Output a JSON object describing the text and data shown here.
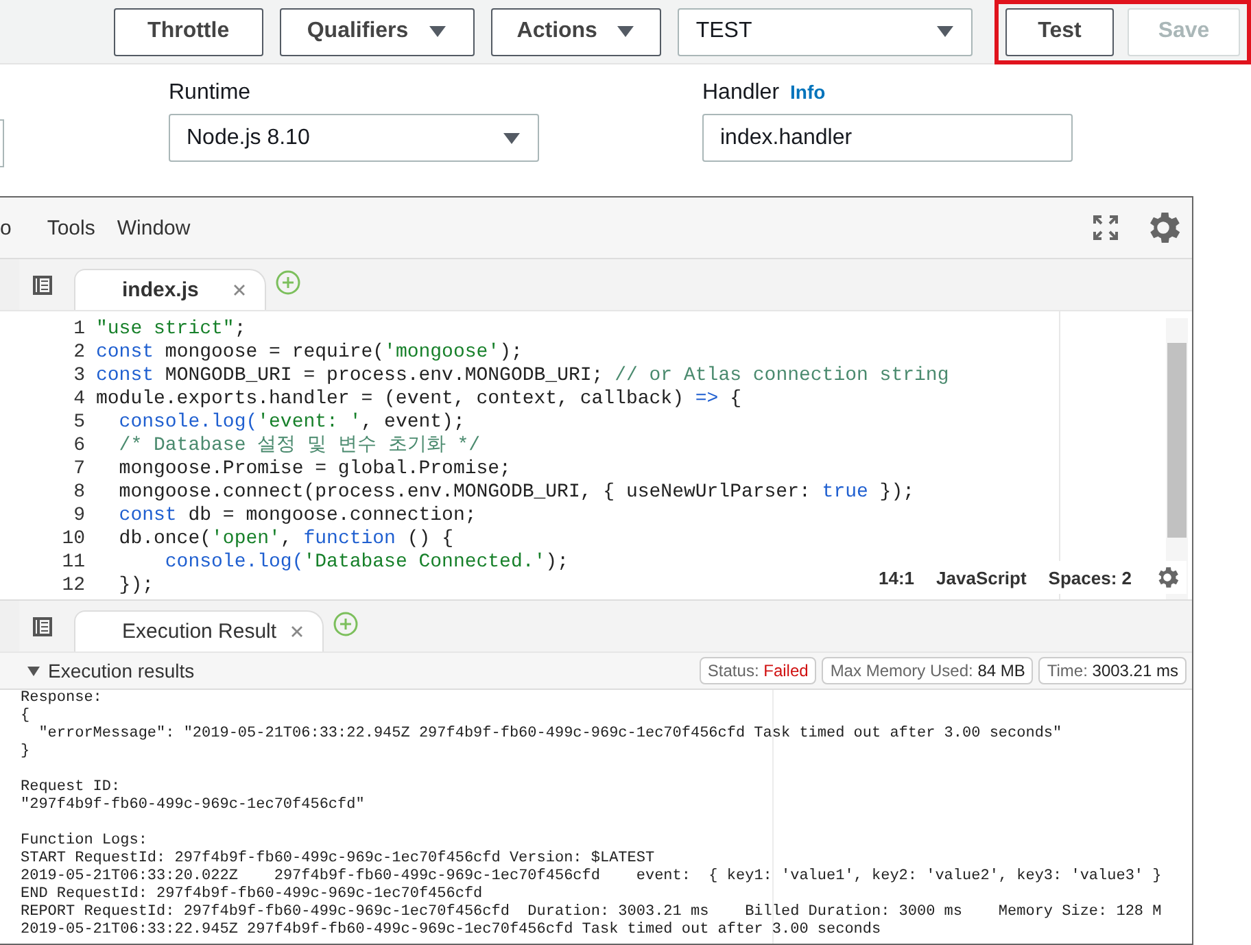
{
  "toolbar": {
    "buttons": [
      {
        "label": "Throttle",
        "kind": "button"
      },
      {
        "label": "Qualifiers",
        "kind": "dropdown"
      },
      {
        "label": "Actions",
        "kind": "dropdown"
      }
    ],
    "test_event": {
      "value": "TEST"
    },
    "actions": [
      {
        "label": "Test",
        "disabled": false
      },
      {
        "label": "Save",
        "disabled": true
      }
    ]
  },
  "settings": {
    "runtime": {
      "label": "Runtime",
      "value": "Node.js 8.10"
    },
    "handler": {
      "label": "Handler",
      "link": "Info",
      "value": "index.handler"
    }
  },
  "editor": {
    "menu": [
      "o",
      "Tools",
      "Window"
    ],
    "tabs": [
      {
        "label": "index.js",
        "selected": true
      }
    ],
    "lines": [
      {
        "number": "1",
        "tokens": [
          {
            "kind": "string",
            "text": "\"use strict\""
          },
          {
            "kind": "plain",
            "text": ";"
          }
        ]
      },
      {
        "number": "2",
        "tokens": [
          {
            "kind": "keyword",
            "text": "const"
          },
          {
            "kind": "plain",
            "text": " mongoose = require("
          },
          {
            "kind": "string",
            "text": "'mongoose'"
          },
          {
            "kind": "plain",
            "text": ");"
          }
        ]
      },
      {
        "number": "3",
        "tokens": [
          {
            "kind": "keyword",
            "text": "const"
          },
          {
            "kind": "plain",
            "text": " MONGODB_URI = process.env.MONGODB_URI; "
          },
          {
            "kind": "comment",
            "text": "// or Atlas connection string"
          }
        ]
      },
      {
        "number": "4",
        "tokens": [
          {
            "kind": "plain",
            "text": "module.exports.handler = (event, context, callback) "
          },
          {
            "kind": "keyword",
            "text": "=>"
          },
          {
            "kind": "plain",
            "text": " {"
          }
        ]
      },
      {
        "number": "5",
        "tokens": [
          {
            "kind": "keyword",
            "text": "  console.log("
          },
          {
            "kind": "string",
            "text": "'event: '"
          },
          {
            "kind": "plain",
            "text": ", event);"
          }
        ]
      },
      {
        "number": "6",
        "tokens": [
          {
            "kind": "comment",
            "text": "  /* Database 설정 및 변수 초기화 */"
          }
        ]
      },
      {
        "number": "7",
        "tokens": [
          {
            "kind": "plain",
            "text": "  mongoose.Promise = global.Promise;"
          }
        ]
      },
      {
        "number": "8",
        "tokens": [
          {
            "kind": "plain",
            "text": "  mongoose.connect(process.env.MONGODB_URI, { useNewUrlParser: "
          },
          {
            "kind": "keyword",
            "text": "true"
          },
          {
            "kind": "plain",
            "text": " });"
          }
        ]
      },
      {
        "number": "9",
        "tokens": [
          {
            "kind": "keyword",
            "text": "  const"
          },
          {
            "kind": "plain",
            "text": " db = mongoose.connection;"
          }
        ]
      },
      {
        "number": "10",
        "tokens": [
          {
            "kind": "plain",
            "text": "  db.once("
          },
          {
            "kind": "string",
            "text": "'open'"
          },
          {
            "kind": "plain",
            "text": ", "
          },
          {
            "kind": "keyword",
            "text": "function"
          },
          {
            "kind": "plain",
            "text": " () {"
          }
        ]
      },
      {
        "number": "11",
        "tokens": [
          {
            "kind": "keyword",
            "text": "      console.log("
          },
          {
            "kind": "string",
            "text": "'Database Connected.'"
          },
          {
            "kind": "plain",
            "text": ");"
          }
        ]
      },
      {
        "number": "12",
        "tokens": [
          {
            "kind": "plain",
            "text": "  });"
          }
        ]
      }
    ],
    "status": {
      "position": "14:1",
      "mode": "JavaScript",
      "indent": "Spaces: 2"
    }
  },
  "console": {
    "tabs": [
      {
        "label": "Execution Result",
        "selected": true
      }
    ],
    "section": {
      "title": "Execution results",
      "expanded": true
    },
    "badges": [
      {
        "label": "Status:",
        "value": "Failed",
        "kind": "error"
      },
      {
        "label": "Max Memory Used:",
        "value": "84 MB",
        "kind": "normal"
      },
      {
        "label": "Time:",
        "value": "3003.21 ms",
        "kind": "normal"
      }
    ],
    "output": [
      [
        "Response:",
        "{",
        "  \"errorMessage\": \"2019-05-21T06:33:22.945Z 297f4b9f-fb60-499c-969c-1ec70f456cfd Task timed out after 3.00 seconds\"",
        "}"
      ],
      [
        "Request ID:",
        "\"297f4b9f-fb60-499c-969c-1ec70f456cfd\""
      ],
      [
        "Function Logs:",
        "START RequestId: 297f4b9f-fb60-499c-969c-1ec70f456cfd Version: $LATEST",
        "2019-05-21T06:33:20.022Z\t297f4b9f-fb60-499c-969c-1ec70f456cfd\tevent:  { key1: 'value1', key2: 'value2', key3: 'value3' }",
        "END RequestId: 297f4b9f-fb60-499c-969c-1ec70f456cfd",
        "REPORT RequestId: 297f4b9f-fb60-499c-969c-1ec70f456cfd  Duration: 3003.21 ms    Billed Duration: 3000 ms    Memory Size: 128 M",
        "2019-05-21T06:33:22.945Z 297f4b9f-fb60-499c-969c-1ec70f456cfd Task timed out after 3.00 seconds"
      ]
    ]
  }
}
